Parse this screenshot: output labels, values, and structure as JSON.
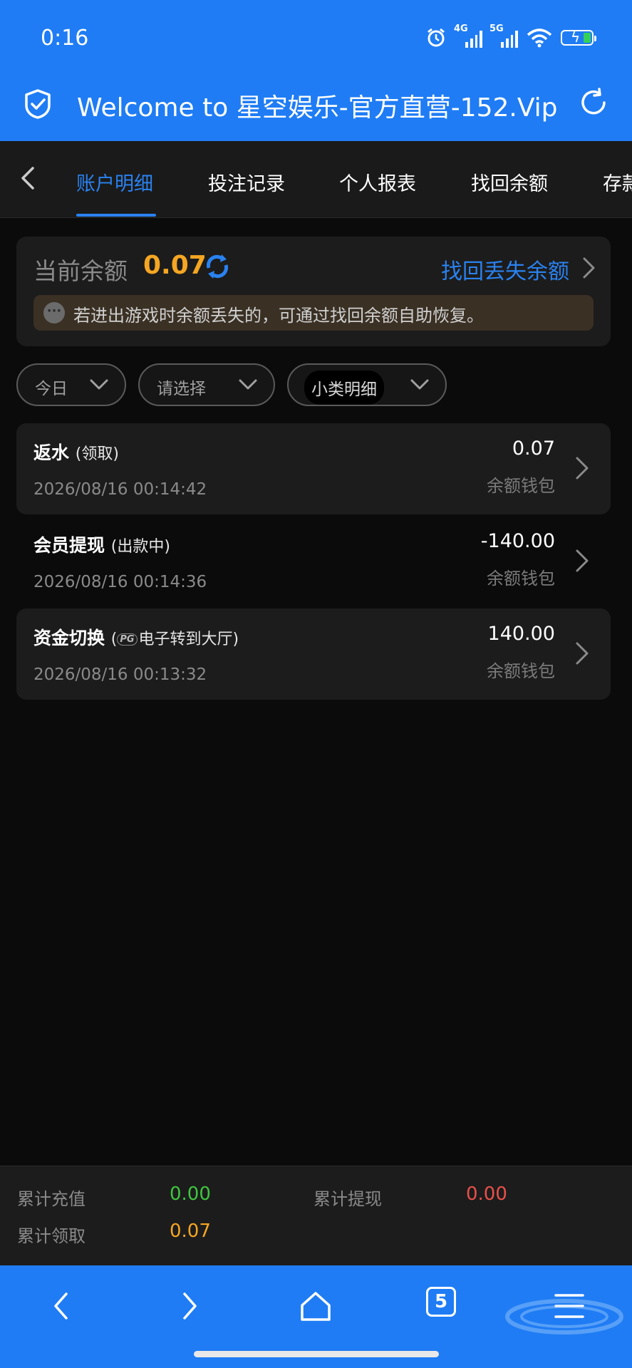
{
  "status_bar": {
    "time": "0:16",
    "net1": "4G",
    "net2": "5G"
  },
  "browser": {
    "title": "Welcome to 星空娱乐-官方直营-152.Vip",
    "tabs_count": "5"
  },
  "tabs": {
    "items": [
      "账户明细",
      "投注记录",
      "个人报表",
      "找回余额",
      "存款"
    ],
    "active_index": 0
  },
  "balance": {
    "label": "当前余额",
    "value": "0.07",
    "recover_link": "找回丢失余额",
    "notice": "若进出游戏时余额丢失的，可通过找回余额自助恢复。"
  },
  "filters": {
    "date": "今日",
    "select": "请选择",
    "detail": "小类明细"
  },
  "records": [
    {
      "title": "返水",
      "sub": "(领取)",
      "badge": "",
      "time": "2026/08/16 00:14:42",
      "amount": "0.07",
      "wallet": "余额钱包"
    },
    {
      "title": "会员提现",
      "sub": "(出款中)",
      "badge": "",
      "time": "2026/08/16 00:14:36",
      "amount": "-140.00",
      "wallet": "余额钱包"
    },
    {
      "title": "资金切换",
      "sub_open": "(",
      "badge": "PG",
      "sub": "电子转到大厅)",
      "time": "2026/08/16 00:13:32",
      "amount": "140.00",
      "wallet": "余额钱包"
    }
  ],
  "summary": {
    "recharge_label": "累计充值",
    "recharge_value": "0.00",
    "withdraw_label": "累计提现",
    "withdraw_value": "0.00",
    "claim_label": "累计领取",
    "claim_value": "0.07"
  },
  "colors": {
    "brand_blue": "#1f7cf4",
    "accent_blue": "#2a82f0",
    "balance_orange": "#f5a623",
    "recharge_green": "#3ec43e",
    "withdraw_red": "#e8504a"
  }
}
